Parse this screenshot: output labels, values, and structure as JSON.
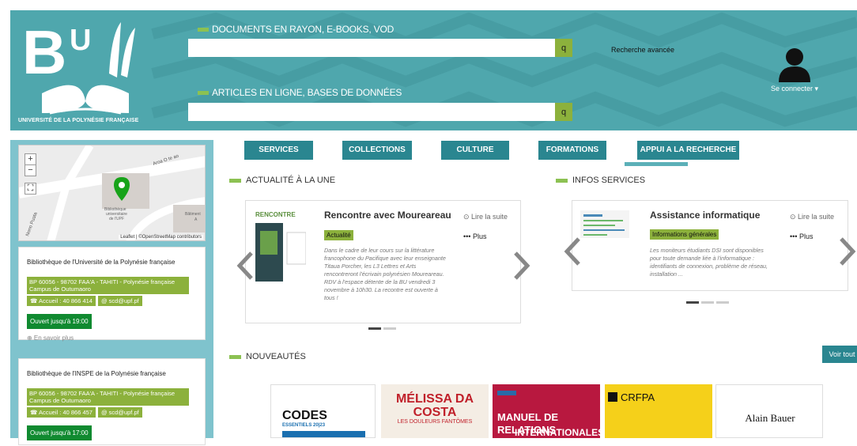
{
  "header": {
    "logo_text": "UNIVERSITÉ DE LA POLYNÉSIE FRANÇAISE",
    "search1": {
      "label": "DOCUMENTS EN RAYON, E-BOOKS, VOD",
      "value": "",
      "button": "q"
    },
    "search2": {
      "label": "ARTICLES EN LIGNE, BASES DE DONNÉES",
      "value": "",
      "button": "q"
    },
    "advanced_search": "Recherche avancée",
    "connect": "Se connecter ▾"
  },
  "sidebar": {
    "map": {
      "zoom_in": "+",
      "zoom_out": "−",
      "fullscreen": "⛶",
      "attribution": "Leaflet | ©OpenStreetMap contributors",
      "street1": "Aroa O te ao",
      "street2": "Nono Puata",
      "marker": "Bibliothèque universitaire de l'UPF",
      "building": "Bâtiment A"
    },
    "libraries": [
      {
        "name": "Bibliothèque de l'Université de la Polynésie française",
        "address": "BP 60056 - 98702 FAA'A - TAHITI - Polynésie française Campus de Outumaoro",
        "phone": "☎ Accueil : 40 866 414",
        "email": "@ scd@upf.pf",
        "open": "Ouvert jusqu'à 19:00",
        "more": "⊕ En savoir plus"
      },
      {
        "name": "Bibliothèque de l'INSPE de la Polynésie française",
        "address": "BP 60056 - 98702 FAA'A - TAHITI - Polynésie française Campus de Outumaoro",
        "phone": "☎ Accueil : 40 866 457",
        "email": "@ scd@upf.pf",
        "open": "Ouvert jusqu'à 17:00"
      }
    ]
  },
  "nav": [
    "SERVICES",
    "COLLECTIONS",
    "CULTURE",
    "FORMATIONS",
    "APPUI A LA RECHERCHE"
  ],
  "actualite": {
    "title": "ACTUALITÉ À LA UNE",
    "card_title": "Rencontre avec Moureareau",
    "badge": "Actualité",
    "desc": "Dans le cadre de leur cours sur la littérature francophone du Pacifique avec leur enseignante Titaua Porcher, les L3 Lettres et Arts rencontreront l'écrivain polynésien Moureareau. RDV à l'espace détente de la BU vendredi 3 novembre à 10h30. La recontre est ouverte à tous !",
    "read": "⊙ Lire la suite",
    "plus": "••• Plus",
    "thumb_label": "RENCONTRE"
  },
  "infos": {
    "title": "INFOS SERVICES",
    "card_title": "Assistance informatique",
    "badge": "Informations générales",
    "desc": "Les moniteurs étudiants DSI sont disponibles pour toute demande liée à l'informatique : identifiants de connexion, problème de réseau, installation ...",
    "read": "⊙ Lire la suite",
    "plus": "••• Plus"
  },
  "nouveautes": {
    "title": "NOUVEAUTÉS",
    "voir": "Voir tout",
    "books": [
      {
        "title": "CODES",
        "sub": "ESSENTIELS 20|23"
      },
      {
        "title": "MÉLISSA DA COSTA",
        "sub": "LES DOULEURS FANTÔMES"
      },
      {
        "title": "MANUEL DE RELATIONS",
        "sub": "INTERNATIONALES"
      },
      {
        "title": "CRFPA",
        "sub": ""
      },
      {
        "title": "Alain Bauer",
        "sub": ""
      }
    ]
  },
  "colors": {
    "teal": "#4fa7ad",
    "dark_teal": "#2a8690",
    "green": "#8cb13c",
    "open_green": "#108a30"
  }
}
